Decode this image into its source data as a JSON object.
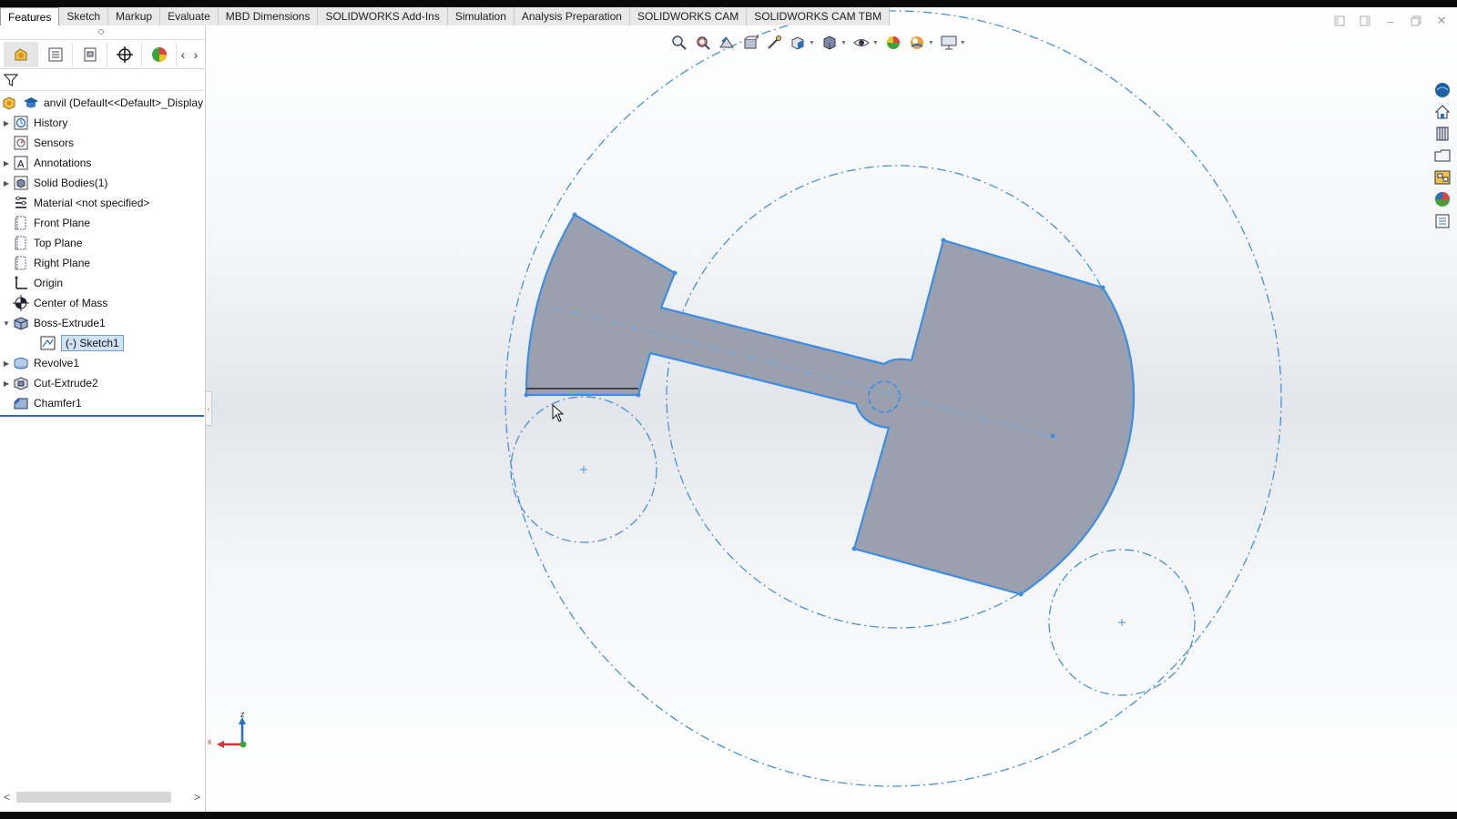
{
  "tabs": [
    "Features",
    "Sketch",
    "Markup",
    "Evaluate",
    "MBD Dimensions",
    "SOLIDWORKS Add-Ins",
    "Simulation",
    "Analysis Preparation",
    "SOLIDWORKS CAM",
    "SOLIDWORKS CAM TBM"
  ],
  "active_tab": "Features",
  "manager_tabs": [
    {
      "name": "featuremanager-tab",
      "icon": "feature-tree-icon"
    },
    {
      "name": "propertymanager-tab",
      "icon": "property-sheet-icon"
    },
    {
      "name": "configurationmanager-tab",
      "icon": "configuration-icon"
    },
    {
      "name": "dimxpertmanager-tab",
      "icon": "crosshair-icon"
    },
    {
      "name": "displaymanager-tab",
      "icon": "appearance-pie-icon"
    }
  ],
  "tree": {
    "root": {
      "label": "anvil  (Default<<Default>_Display",
      "icon": "part-icon"
    },
    "items": [
      {
        "label": "History",
        "icon": "history-icon",
        "expandable": true,
        "expanded": false,
        "indent": 0
      },
      {
        "label": "Sensors",
        "icon": "sensors-icon",
        "expandable": false,
        "expanded": false,
        "indent": 0
      },
      {
        "label": "Annotations",
        "icon": "annotations-icon",
        "expandable": true,
        "expanded": false,
        "indent": 0
      },
      {
        "label": "Solid Bodies(1)",
        "icon": "solid-bodies-icon",
        "expandable": true,
        "expanded": false,
        "indent": 0
      },
      {
        "label": "Material <not specified>",
        "icon": "material-icon",
        "expandable": false,
        "expanded": false,
        "indent": 0
      },
      {
        "label": "Front Plane",
        "icon": "plane-icon",
        "expandable": false,
        "expanded": false,
        "indent": 0
      },
      {
        "label": "Top Plane",
        "icon": "plane-icon",
        "expandable": false,
        "expanded": false,
        "indent": 0
      },
      {
        "label": "Right Plane",
        "icon": "plane-icon",
        "expandable": false,
        "expanded": false,
        "indent": 0
      },
      {
        "label": "Origin",
        "icon": "origin-icon",
        "expandable": false,
        "expanded": false,
        "indent": 0
      },
      {
        "label": "Center of Mass",
        "icon": "center-of-mass-icon",
        "expandable": false,
        "expanded": false,
        "indent": 0
      },
      {
        "label": "Boss-Extrude1",
        "icon": "boss-extrude-icon",
        "expandable": true,
        "expanded": true,
        "indent": 0
      },
      {
        "label": "(-) Sketch1",
        "icon": "sketch-icon",
        "expandable": false,
        "expanded": false,
        "indent": 1,
        "selected": true
      },
      {
        "label": "Revolve1",
        "icon": "revolve-icon",
        "expandable": true,
        "expanded": false,
        "indent": 0
      },
      {
        "label": "Cut-Extrude2",
        "icon": "cut-extrude-icon",
        "expandable": true,
        "expanded": false,
        "indent": 0
      },
      {
        "label": "Chamfer1",
        "icon": "chamfer-icon",
        "expandable": false,
        "expanded": false,
        "indent": 0
      }
    ]
  },
  "heads_up_toolbar": [
    "zoom-to-fit-icon",
    "zoom-to-area-icon",
    "previous-view-icon",
    "section-view-icon",
    "dynamic-annotation-icon",
    "view-orientation-icon",
    "display-style-icon",
    "hide-show-items-icon",
    "edit-appearance-icon",
    "apply-scene-icon",
    "view-settings-icon"
  ],
  "task_pane": [
    "solidworks-resources-icon",
    "home-icon",
    "design-library-icon",
    "file-explorer-icon",
    "view-palette-icon",
    "appearances-icon",
    "custom-properties-icon"
  ],
  "triad": {
    "z_label": "z",
    "x_label": "x"
  },
  "colors": {
    "part_fill": "#9aa0ae",
    "edge_highlight": "#3d8de6",
    "construction": "#4a8fd6",
    "selection": "#cfe2f6"
  }
}
